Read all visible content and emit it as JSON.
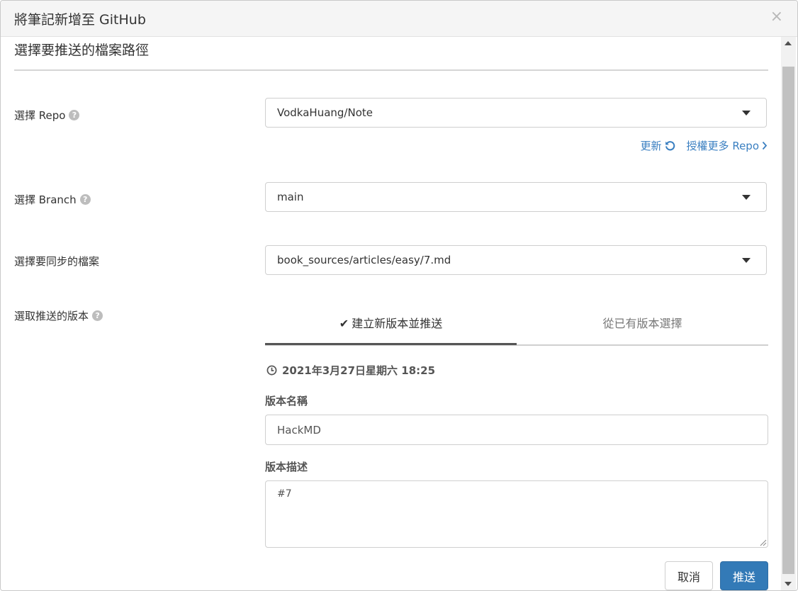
{
  "dialog": {
    "title": "將筆記新增至 GitHub",
    "close_label": "×"
  },
  "section": {
    "title": "選擇要推送的檔案路徑"
  },
  "repo": {
    "label": "選擇 Repo",
    "value": "VodkaHuang/Note",
    "refresh_link": "更新",
    "authorize_link": "授權更多 Repo"
  },
  "branch": {
    "label": "選擇 Branch",
    "value": "main"
  },
  "file": {
    "label": "選擇要同步的檔案",
    "value": "book_sources/articles/easy/7.md"
  },
  "version": {
    "label": "選取推送的版本",
    "tabs": [
      {
        "label": "建立新版本並推送",
        "active": true
      },
      {
        "label": "從已有版本選擇",
        "active": false
      }
    ],
    "timestamp": "2021年3月27日星期六 18:25",
    "name_label": "版本名稱",
    "name_value": "HackMD",
    "desc_label": "版本描述",
    "desc_value": "#7"
  },
  "buttons": {
    "cancel": "取消",
    "push": "推送"
  },
  "colors": {
    "primary": "#337ab7",
    "link": "#3a7fc1",
    "header_bg": "#f5f5f5"
  }
}
